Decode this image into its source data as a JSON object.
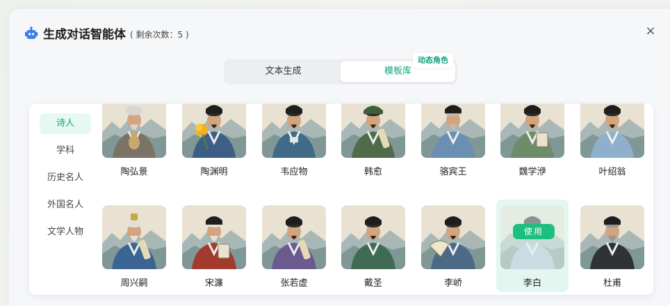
{
  "header": {
    "title": "生成对话智能体",
    "remaining": "( 剩余次数：5 )"
  },
  "close_icon": "×",
  "tabs": [
    {
      "label": "文本生成",
      "active": false
    },
    {
      "label": "模板库",
      "active": true
    }
  ],
  "tab_badge": "动态角色",
  "categories": [
    {
      "label": "诗人",
      "active": true
    },
    {
      "label": "学科",
      "active": false
    },
    {
      "label": "历史名人",
      "active": false
    },
    {
      "label": "外国名人",
      "active": false
    },
    {
      "label": "文学人物",
      "active": false
    }
  ],
  "characters": [
    {
      "name": "陶弘景",
      "robe": "#7b7365",
      "hat": "none",
      "hair": "#d8d6d0",
      "prop": "gourd"
    },
    {
      "name": "陶渊明",
      "robe": "#3e5f85",
      "hat": "black",
      "hair": "#2a2a2a",
      "prop": "flower"
    },
    {
      "name": "韦应物",
      "robe": "#3f6b88",
      "hat": "black",
      "hair": "#2a2a2a",
      "prop": "cup"
    },
    {
      "name": "韩愈",
      "robe": "#4f6b48",
      "hat": "green",
      "hair": "#2a2a2a",
      "prop": "scroll"
    },
    {
      "name": "骆宾王",
      "robe": "#6a8fb3",
      "hat": "black",
      "hair": "#bdbab2",
      "prop": "none"
    },
    {
      "name": "魏学洢",
      "robe": "#6d8c6a",
      "hat": "black",
      "hair": "#2a2a2a",
      "prop": "book"
    },
    {
      "name": "叶绍翁",
      "robe": "#8fb0cc",
      "hat": "black",
      "hair": "#2a2a2a",
      "prop": "none"
    },
    {
      "name": "周兴嗣",
      "robe": "#3b6493",
      "hat": "gold",
      "hair": "#e2e0da",
      "prop": "scroll"
    },
    {
      "name": "宋濂",
      "robe": "#a23a2e",
      "hat": "black",
      "hair": "#e2e0da",
      "prop": "book"
    },
    {
      "name": "张若虚",
      "robe": "#6a5a8e",
      "hat": "black",
      "hair": "#2a2a2a",
      "prop": "scroll"
    },
    {
      "name": "戴圣",
      "robe": "#3f6b55",
      "hat": "black",
      "hair": "#2a2a2a",
      "prop": "none"
    },
    {
      "name": "李峤",
      "robe": "#4b6a86",
      "hat": "black",
      "hair": "#2a2a2a",
      "prop": "fan"
    },
    {
      "name": "李白",
      "robe": "#a9bccf",
      "hat": "black",
      "hair": "#2a2a2a",
      "prop": "none",
      "selected": true
    },
    {
      "name": "杜甫",
      "robe": "#2f3336",
      "hat": "black",
      "hair": "#9a9690",
      "prop": "none"
    }
  ],
  "use_button_label": "使用"
}
